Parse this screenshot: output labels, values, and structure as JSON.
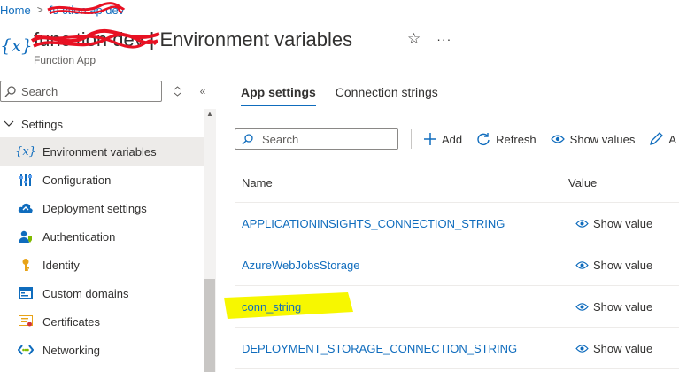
{
  "breadcrumb": {
    "home": "Home",
    "app": "fu ction ap   dev"
  },
  "header": {
    "app_name": "func  tion  dev",
    "separator": "|",
    "page_title": "Environment variables",
    "subtitle": "Function App",
    "resource_icon": "{x}"
  },
  "sidebar": {
    "search_placeholder": "Search",
    "group_label": "Settings",
    "items": [
      {
        "label": "Environment variables",
        "icon": "variable-icon"
      },
      {
        "label": "Configuration",
        "icon": "sliders-icon"
      },
      {
        "label": "Deployment settings",
        "icon": "cloud-sync-icon"
      },
      {
        "label": "Authentication",
        "icon": "user-shield-icon"
      },
      {
        "label": "Identity",
        "icon": "key-icon"
      },
      {
        "label": "Custom domains",
        "icon": "domain-icon"
      },
      {
        "label": "Certificates",
        "icon": "certificate-icon"
      },
      {
        "label": "Networking",
        "icon": "network-icon"
      }
    ]
  },
  "tabs": [
    {
      "label": "App settings",
      "active": true
    },
    {
      "label": "Connection strings",
      "active": false
    }
  ],
  "toolbar": {
    "search_placeholder": "Search",
    "add": "Add",
    "refresh": "Refresh",
    "show_values": "Show values",
    "edit_partial": "A"
  },
  "grid": {
    "columns": [
      "Name",
      "Value"
    ],
    "rows": [
      {
        "name": "APPLICATIONINSIGHTS_CONNECTION_STRING",
        "value": "Show value"
      },
      {
        "name": "AzureWebJobsStorage",
        "value": "Show value"
      },
      {
        "name": "conn_string",
        "value": "Show value",
        "highlighted": true
      },
      {
        "name": "DEPLOYMENT_STORAGE_CONNECTION_STRING",
        "value": "Show value"
      }
    ]
  },
  "colors": {
    "accent": "#0f6cbd",
    "highlight": "#f7f700",
    "redaction": "#e81123"
  }
}
